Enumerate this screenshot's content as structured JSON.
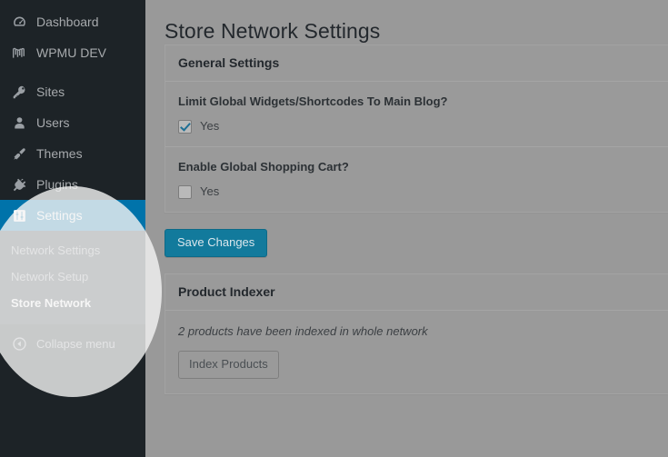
{
  "page": {
    "title": "Store Network Settings"
  },
  "sidebar": {
    "items": [
      {
        "label": "Dashboard",
        "icon": "dashboard-gauge-icon"
      },
      {
        "label": "WPMU DEV",
        "icon": "wpmudev-logo-icon"
      },
      {
        "label": "Sites",
        "icon": "key-icon"
      },
      {
        "label": "Users",
        "icon": "user-icon"
      },
      {
        "label": "Themes",
        "icon": "paintbrush-icon"
      },
      {
        "label": "Plugins",
        "icon": "plug-icon"
      },
      {
        "label": "Settings",
        "icon": "sliders-icon"
      }
    ],
    "submenu": [
      {
        "label": "Network Settings",
        "active": false
      },
      {
        "label": "Network Setup",
        "active": false
      },
      {
        "label": "Store Network",
        "active": true
      }
    ],
    "collapse": {
      "label": "Collapse menu",
      "icon": "collapse-left-arrow-icon"
    },
    "colors": {
      "background": "#1d2327",
      "submenu_background": "#2c3338",
      "current_highlight": "#0073aa",
      "text": "#a7aaad"
    }
  },
  "general_settings": {
    "header": "General Settings",
    "fields": [
      {
        "label": "Limit Global Widgets/Shortcodes To Main Blog?",
        "checkbox_label": "Yes",
        "checked": true
      },
      {
        "label": "Enable Global Shopping Cart?",
        "checkbox_label": "Yes",
        "checked": false
      }
    ]
  },
  "actions": {
    "save_label": "Save Changes"
  },
  "product_indexer": {
    "header": "Product Indexer",
    "status": "2 products have been indexed in whole network",
    "button_label": "Index Products"
  },
  "colors": {
    "overlay_background": "#999999",
    "primary_button": "#127a9c",
    "spotlight": "#f4f4f4"
  }
}
